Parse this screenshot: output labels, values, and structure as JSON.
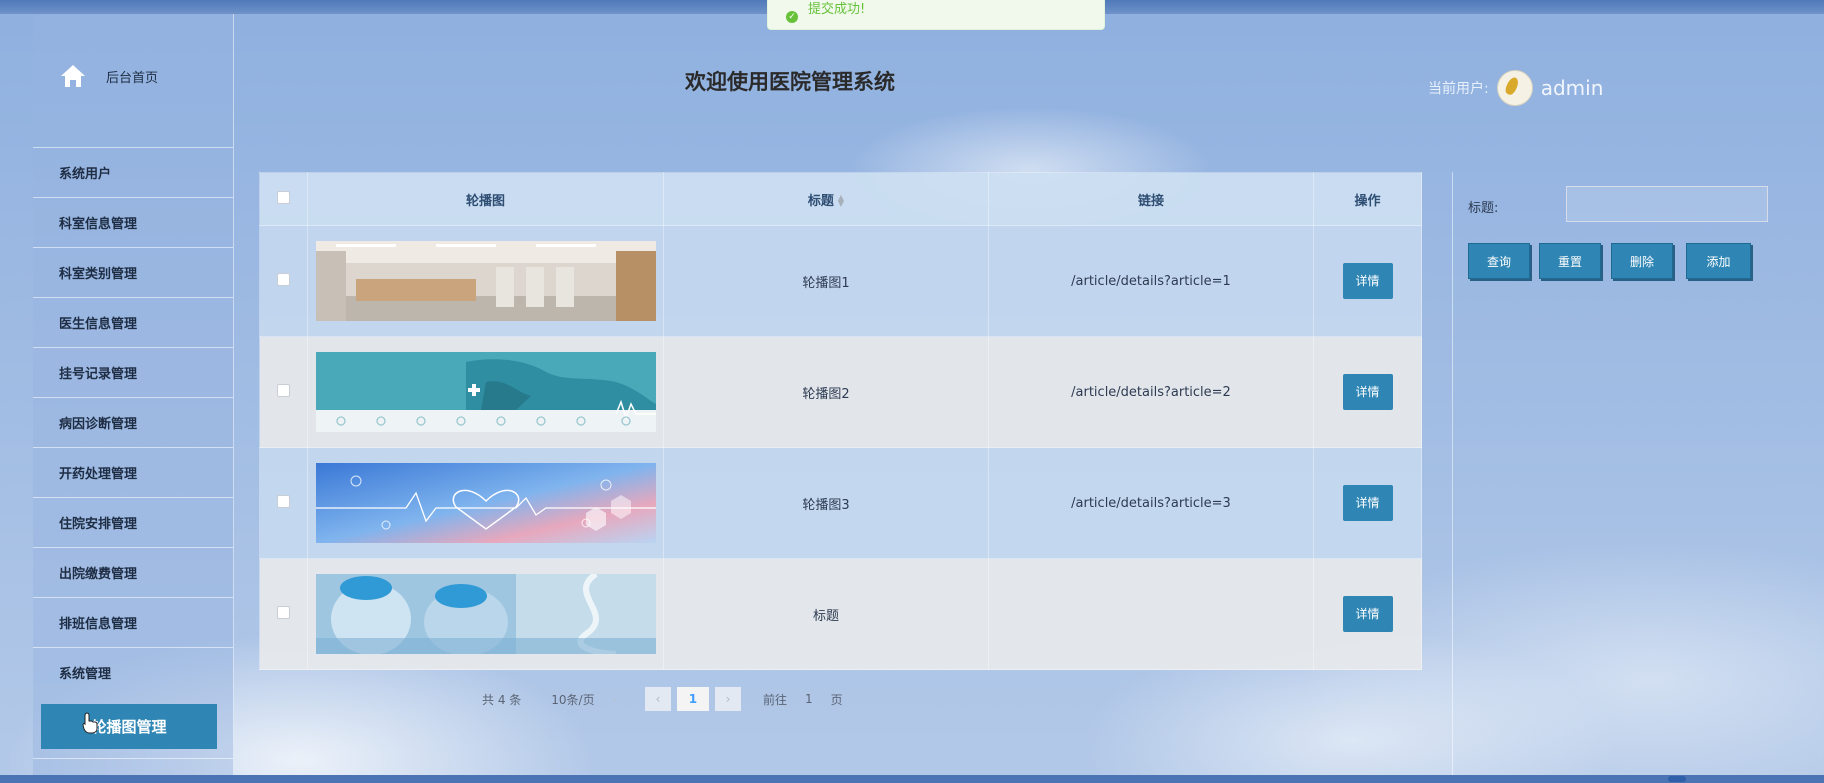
{
  "toast": {
    "message": "提交成功!",
    "icon": "check-circle-icon"
  },
  "sidebar": {
    "home_label": "后台首页",
    "items": [
      "系统用户",
      "科室信息管理",
      "科室类别管理",
      "医生信息管理",
      "挂号记录管理",
      "病因诊断管理",
      "开药处理管理",
      "住院安排管理",
      "出院缴费管理",
      "排班信息管理",
      "系统管理"
    ],
    "active_sub": "轮播图管理"
  },
  "header": {
    "title": "欢迎使用医院管理系统",
    "user_label": "当前用户:",
    "user_name": "admin"
  },
  "table": {
    "columns": [
      "轮播图",
      "标题",
      "链接",
      "操作"
    ],
    "rows": [
      {
        "title": "轮播图1",
        "link": "/article/details?article=1",
        "action": "详情",
        "image": "hospital-hallway"
      },
      {
        "title": "轮播图2",
        "link": "/article/details?article=2",
        "action": "详情",
        "image": "medical-world-map"
      },
      {
        "title": "轮播图3",
        "link": "/article/details?article=3",
        "action": "详情",
        "image": "heartbeat-banner"
      },
      {
        "title": "标题",
        "link": "",
        "action": "详情",
        "image": "doctors-lab"
      }
    ]
  },
  "pagination": {
    "total": "共 4 条",
    "page_size": "10条/页",
    "current_page": "1",
    "goto_label": "前往",
    "goto_value": "1",
    "page_suffix": "页"
  },
  "search": {
    "label": "标题:",
    "value": "",
    "buttons": {
      "query": "查询",
      "reset": "重置",
      "delete": "删除",
      "add": "添加"
    }
  },
  "colors": {
    "accent": "#2f86b5",
    "toast_success": "#67c23a",
    "page_active": "#409eff"
  }
}
